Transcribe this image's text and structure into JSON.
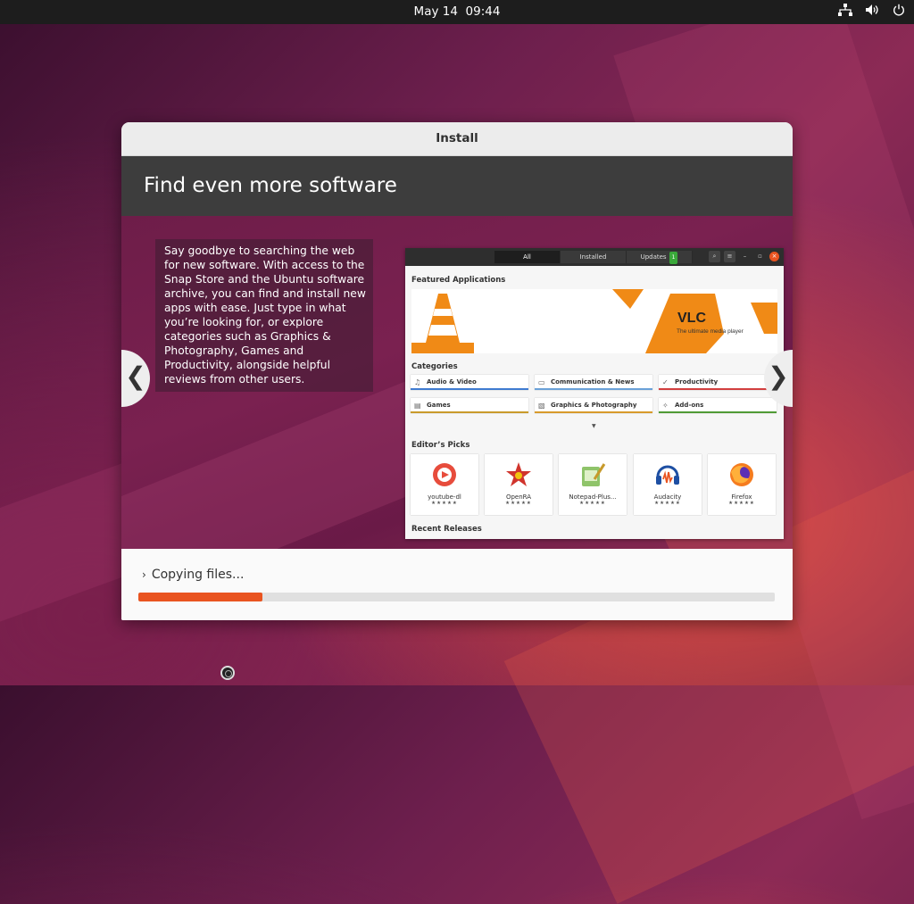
{
  "topbar": {
    "date": "May 14",
    "time": "09:44",
    "tray_icons": [
      "network-icon",
      "volume-icon",
      "power-icon"
    ]
  },
  "window": {
    "title": "Install",
    "banner": "Find even more software",
    "description": "Say goodbye to searching the web for new software. With access to the Snap Store and the Ubuntu software archive, you can find and install new apps with ease. Just type in what you’re looking for, or explore categories such as Graphics & Photography, Games and Productivity, alongside helpful reviews from other users.",
    "prev_label": "❮",
    "next_label": "❯"
  },
  "store_screenshot": {
    "tabs": [
      "All",
      "Installed",
      "Updates"
    ],
    "updates_badge": "1",
    "featured_heading": "Featured Applications",
    "featured_app": {
      "name": "VLC",
      "tagline": "The ultimate media player"
    },
    "categories_heading": "Categories",
    "categories": [
      {
        "label": "Audio & Video",
        "color": "#3f7bd0",
        "icon": "♫"
      },
      {
        "label": "Communication & News",
        "color": "#6aa1d8",
        "icon": "▭"
      },
      {
        "label": "Productivity",
        "color": "#d23f3f",
        "icon": "✓"
      },
      {
        "label": "Games",
        "color": "#c99a2b",
        "icon": "▤"
      },
      {
        "label": "Graphics & Photography",
        "color": "#d89a2b",
        "icon": "▧"
      },
      {
        "label": "Add-ons",
        "color": "#4f9a35",
        "icon": "✧"
      }
    ],
    "editors_heading": "Editor’s Picks",
    "picks": [
      {
        "name": "youtube-dl",
        "stars": "★★★★★"
      },
      {
        "name": "OpenRA",
        "stars": "★★★★★"
      },
      {
        "name": "Notepad-Plus...",
        "stars": "★★★★★"
      },
      {
        "name": "Audacity",
        "stars": "★★★★★"
      },
      {
        "name": "Firefox",
        "stars": "★★★★★"
      }
    ],
    "recent_heading": "Recent Releases"
  },
  "footer": {
    "status": "Copying files...",
    "expander": "›",
    "progress": 0.195
  },
  "colors": {
    "accent": "#e95420",
    "banner_bg": "#3d3d3d",
    "topbar_bg": "#1d1d1d"
  }
}
